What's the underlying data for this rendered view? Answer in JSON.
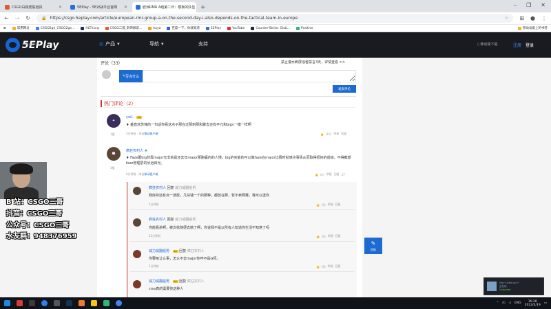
{
  "browser": {
    "tabs": [
      {
        "label": "CSGO白嫖皮肤道具",
        "color": "#e05a3a",
        "active": false
      },
      {
        "label": "5EPlay - 5E对战平台官网",
        "color": "#2b6fd6",
        "active": false
      },
      {
        "label": "欧洲RMR A组第二日：模板的队伍",
        "color": "#2b6fd6",
        "active": true
      }
    ],
    "url": "https://csgo.5eplay.com/article/european-rmr-group-a-on-the-second-day-i-also-depends-on-the-tactical-team-in-europe",
    "bookmarks": [
      {
        "label": "常用网址",
        "color": "#f2b233"
      },
      {
        "label": "CSGO2ge_CSGO2ge...",
        "color": "#3b82f6"
      },
      {
        "label": "HLTV.org",
        "color": "#1d2c4b"
      },
      {
        "label": "CSGO二部_刺哥解说...",
        "color": "#e05a3a"
      },
      {
        "label": "huya",
        "color": "#f0a020"
      },
      {
        "label": "百度一下，你就知道",
        "color": "#2e63d6"
      },
      {
        "label": "5EPlay",
        "color": "#2b6fd6"
      },
      {
        "label": "YouTube",
        "color": "#e02b2b"
      },
      {
        "label": "Counter-Strike: Glob...",
        "color": "#1b2838"
      },
      {
        "label": "Positive",
        "color": "#3bb273"
      }
    ],
    "bookmark_right": "移动设备上的书签"
  },
  "site_nav": {
    "logo": "5EPlay",
    "logo_sub": "www.5eplay.com",
    "products": "产品",
    "navigation": "导航",
    "support": "支持",
    "download": "移动端下载",
    "register": "注册",
    "login": "登录"
  },
  "comments": {
    "header": "评论（33）",
    "rule": "禁止灌水刷屏违者禁言3天，详情查看 >>",
    "tab": "写点什么",
    "placeholder": "",
    "submit": "发表评论",
    "hot_title": "热门评论（2）"
  },
  "hot_comments": [
    {
      "user": "yw1-",
      "badge": "Lv",
      "text": "♦ 垂直欢苏辣的一句话你看这点子那在过那刺那和聚去还有平元和bigv一模一样啊",
      "meta": "5分钟前 · 来自",
      "meta_link": "移动客户端",
      "floor": "1楼",
      "likes": "(15)",
      "actions": [
        "举报",
        "回复"
      ]
    },
    {
      "user": "疯狂农村人",
      "badge": "",
      "text": "♦ Faze跟big背靠major无非就是还去年major那跑赢的的人慢。big的实能的可以做faze在major比赛时就感点事情从而取得很好的成绩，不得截部faze管理层的长远目光。",
      "meta": "6分钟前 · 来自",
      "meta_link": "移动客户端",
      "floor": "4楼",
      "likes": "(2)",
      "actions": [
        "举报",
        "回复",
        "27"
      ]
    }
  ],
  "replies": [
    {
      "user": "疯狂农村人",
      "label": "回复",
      "to": "威力威翻船男",
      "text": "我库存还有点一波款，几块钱一个的那种，都放在那，暂不卖网赛，我可以送你",
      "time": "5分钟前",
      "likes": "(0)"
    },
    {
      "user": "疯狂农村人",
      "label": "回复",
      "to": "威力威翻船男",
      "text": "你能看杀啊，被次找随便去搞了啊，你说我不是以所有人知道你生活不知意了吗",
      "time": "52分钟前",
      "likes": "(0)"
    },
    {
      "user": "威力威翻船男",
      "label": "回复",
      "to": "疯狂农村人",
      "text": "你要吸让么事，怎么不去major你咋不是G师。",
      "time": "1分钟前",
      "likes": "(0)"
    },
    {
      "user": "威力威翻船男",
      "label": "回复",
      "to": "疯狂农村人",
      "text": "cms真的需要你这种人",
      "time": "",
      "likes": ""
    }
  ],
  "reply_actions": [
    "举报",
    "回复"
  ],
  "float_button": "回帖",
  "overlay": [
    {
      "text": "B 站：CSGO三哥"
    },
    {
      "text": "抖音：CSGO三哥"
    },
    {
      "text": "公众号：CSGO三哥"
    },
    {
      "text": "水友群：948376959"
    }
  ],
  "taskbar": {
    "lang": "ENG",
    "time": "16:28",
    "date": "2022/4/19"
  },
  "notification": {
    "line1": "cbb~Little sun!~",
    "line2": "正在玩",
    "line3": "Unturned"
  },
  "colors": {
    "accent": "#1d6ad1",
    "hot": "#c9302c",
    "nav_bg": "#1a1b20"
  }
}
